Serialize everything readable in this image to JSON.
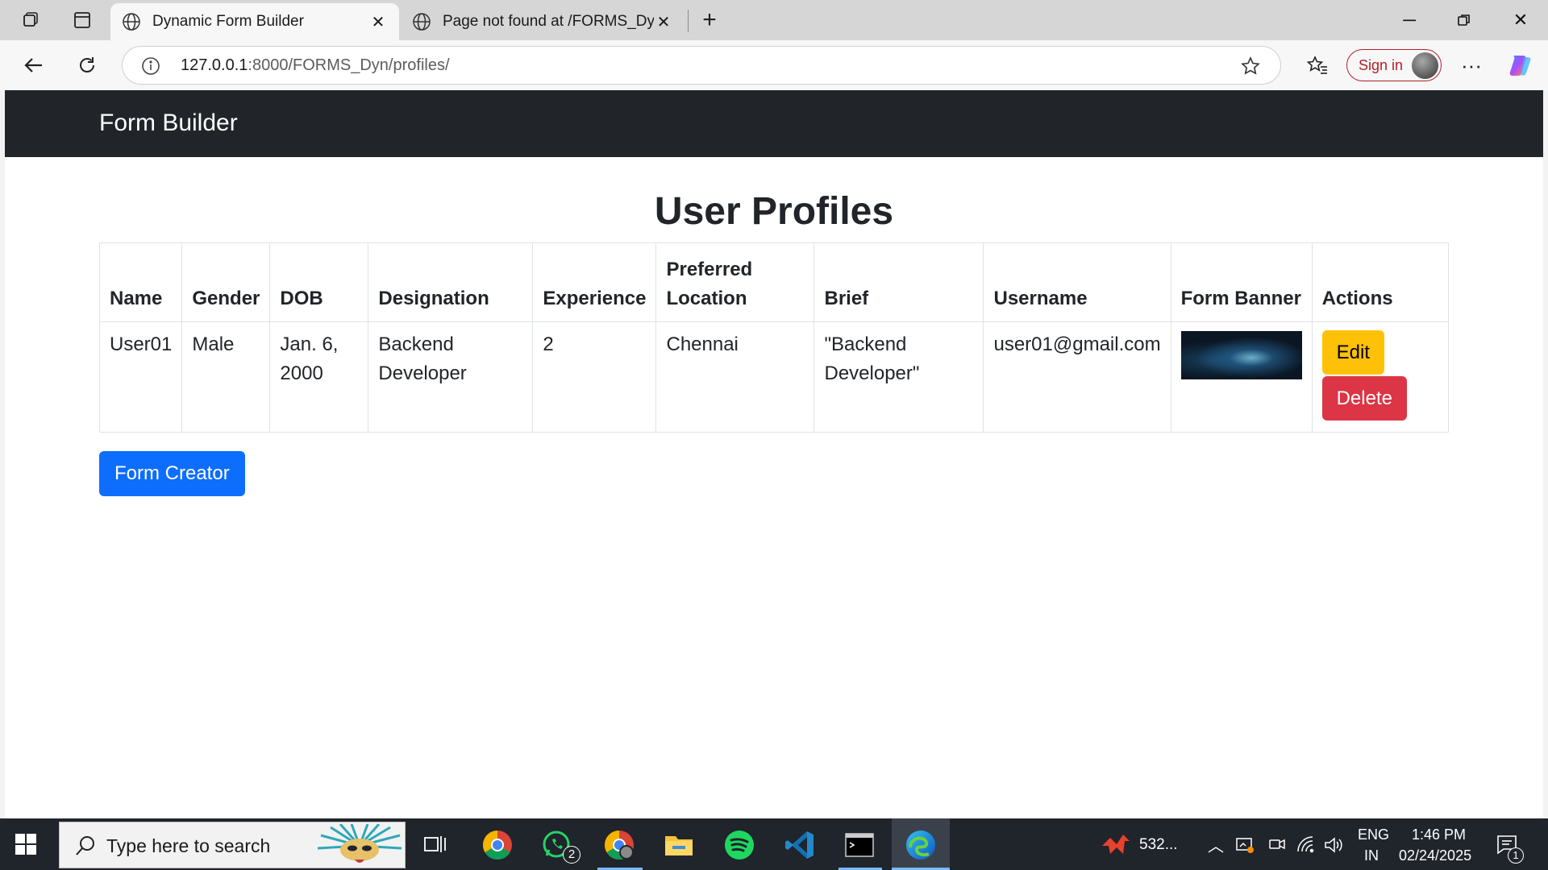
{
  "browser": {
    "tabs": [
      {
        "title": "Dynamic Form Builder",
        "active": true
      },
      {
        "title": "Page not found at /FORMS_Dyn/f",
        "active": false
      }
    ],
    "url_host": "127.0.0.1",
    "url_rest": ":8000/FORMS_Dyn/profiles/",
    "sign_in_label": "Sign in"
  },
  "page": {
    "brand": "Form Builder",
    "heading": "User Profiles",
    "table": {
      "headers": [
        "Name",
        "Gender",
        "DOB",
        "Designation",
        "Experience",
        "Preferred Location",
        "Brief",
        "Username",
        "Form Banner",
        "Actions"
      ],
      "rows": [
        {
          "name": "User01",
          "gender": "Male",
          "dob": "Jan. 6, 2000",
          "designation": "Backend Developer",
          "experience": "2",
          "location": "Chennai",
          "brief": "\"Backend Developer\"",
          "username": "user01@gmail.com"
        }
      ],
      "edit_label": "Edit",
      "delete_label": "Delete"
    },
    "form_creator_label": "Form Creator",
    "colors": {
      "navbar": "#212529",
      "edit": "#ffc107",
      "delete": "#dc3545",
      "primary": "#0d6efd"
    }
  },
  "taskbar": {
    "search_placeholder": "Type here to search",
    "whatsapp_badge": "2",
    "tray_app_label": "532...",
    "language": "ENG",
    "region": "IN",
    "time": "1:46 PM",
    "date": "02/24/2025",
    "notification_count": "1"
  }
}
